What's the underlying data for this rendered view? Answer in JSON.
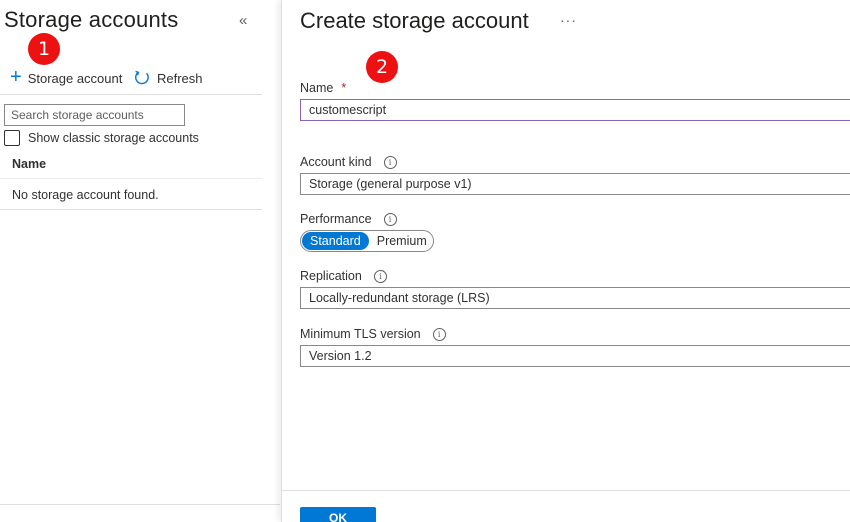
{
  "left_panel": {
    "title": "Storage accounts",
    "collapse_glyph": "«",
    "toolbar": {
      "add_label": "Storage account",
      "add_icon": "plus-icon",
      "refresh_label": "Refresh",
      "refresh_icon": "refresh-icon"
    },
    "search": {
      "placeholder": "Search storage accounts",
      "value": ""
    },
    "classic_checkbox": {
      "label": "Show classic storage accounts",
      "checked": false
    },
    "table": {
      "columns": [
        "Name"
      ],
      "empty_message": "No storage account found."
    }
  },
  "right_panel": {
    "title": "Create storage account",
    "more_glyph": "···",
    "fields": {
      "name": {
        "label": "Name",
        "required_marker": "*",
        "value": "customescript"
      },
      "account_kind": {
        "label": "Account kind",
        "value": "Storage (general purpose v1)"
      },
      "performance": {
        "label": "Performance",
        "options": [
          "Standard",
          "Premium"
        ],
        "selected": "Standard"
      },
      "replication": {
        "label": "Replication",
        "value": "Locally-redundant storage (LRS)"
      },
      "min_tls": {
        "label": "Minimum TLS version",
        "value": "Version 1.2"
      }
    },
    "ok_label": "OK"
  },
  "annotations": {
    "step1": "1",
    "step2": "2"
  },
  "colors": {
    "accent": "#0078d4",
    "badge": "#ee1111",
    "input_focus_border": "#8764b8",
    "required": "#a4262c"
  }
}
